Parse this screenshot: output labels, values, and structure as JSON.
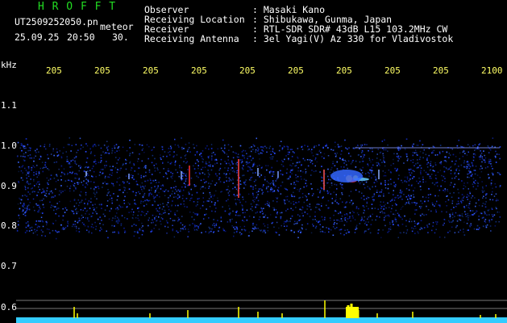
{
  "app": {
    "brand": "H R O F F T",
    "file_name": "UT2509252050.pn",
    "tag": "meteor",
    "date": "25.09.25",
    "time": "20:50",
    "duration": "30."
  },
  "info": {
    "labels": [
      "Observer",
      "Receiving Location",
      "Receiver",
      "Receiving Antenna"
    ],
    "values": [
      ": Masaki Kano",
      ": Shibukawa, Gunma, Japan",
      ": RTL-SDR SDR# 43dB L15 103.2MHz CW",
      ": 3el Yagi(V) Az 330 for Vladivostok"
    ]
  },
  "axes": {
    "freq_unit": "kHz",
    "freq_ticks": [
      "1.1",
      "1.0",
      "0.9",
      "0.8",
      "0.7",
      "0.6"
    ],
    "time_ticks": [
      "205",
      "205",
      "205",
      "205",
      "205",
      "205",
      "205",
      "205",
      "205",
      "2100"
    ]
  },
  "colors": {
    "background": "#000000",
    "text": "#ffffff",
    "ticks": "#ffff66",
    "brand": "#22dd22",
    "noise": "#1a3cff",
    "baseline": "#33ccff",
    "spikes": "#ffff00"
  }
}
